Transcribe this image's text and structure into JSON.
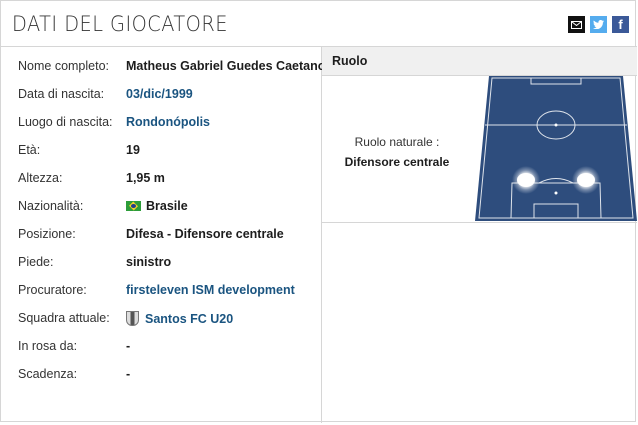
{
  "header": {
    "title": "DATI DEL GIOCATORE"
  },
  "share": {
    "mail_icon": "envelope-icon",
    "twitter_icon": "twitter-icon",
    "facebook_icon": "facebook-icon",
    "facebook_glyph": "f"
  },
  "details": {
    "rows": [
      {
        "label": "Nome completo:",
        "value": "Matheus Gabriel Guedes Caetano"
      },
      {
        "label": "Data di nascita:",
        "value": "03/dic/1999"
      },
      {
        "label": "Luogo di nascita:",
        "value": "Rondonópolis"
      },
      {
        "label": "Età:",
        "value": "19"
      },
      {
        "label": "Altezza:",
        "value": "1,95 m"
      },
      {
        "label": "Nazionalità:",
        "value": "Brasile"
      },
      {
        "label": "Posizione:",
        "value": "Difesa - Difensore centrale"
      },
      {
        "label": "Piede:",
        "value": "sinistro"
      },
      {
        "label": "Procuratore:",
        "value": "firsteleven ISM development"
      },
      {
        "label": "Squadra attuale:",
        "value": "Santos FC U20"
      },
      {
        "label": "In rosa da:",
        "value": "-"
      },
      {
        "label": "Scadenza:",
        "value": "-"
      }
    ]
  },
  "ruolo": {
    "heading": "Ruolo",
    "natural_label": "Ruolo naturale :",
    "natural_value": "Difensore centrale"
  },
  "colors": {
    "link": "#1a5480",
    "pitch": "#2e4d7d"
  }
}
